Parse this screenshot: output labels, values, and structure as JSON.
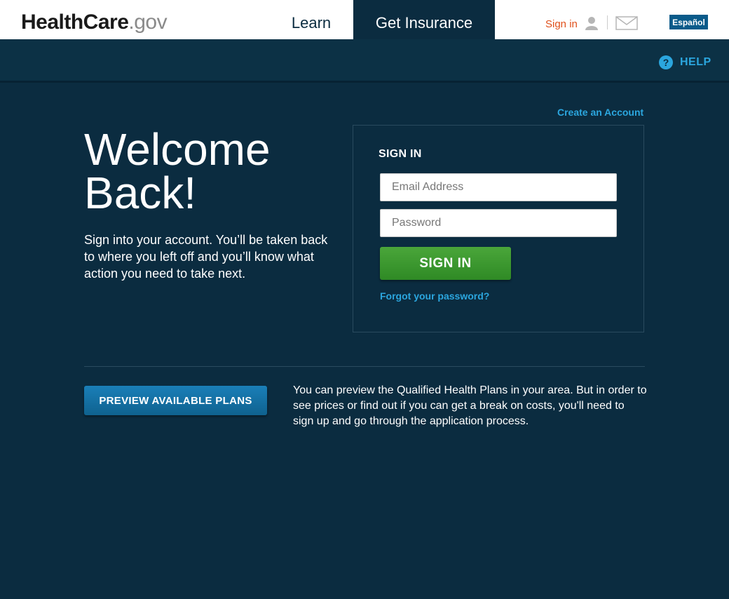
{
  "header": {
    "logo_brand": "HealthCare",
    "logo_dot": ".",
    "logo_tld": "gov",
    "nav": {
      "learn": "Learn",
      "get_insurance": "Get Insurance"
    },
    "sign_in": "Sign in",
    "espanol": "Español"
  },
  "helpbar": {
    "help_icon": "?",
    "help_label": "HELP"
  },
  "main": {
    "create_account": "Create an Account",
    "welcome_line1": "Welcome",
    "welcome_line2": "Back!",
    "intro": "Sign into your account. You’ll be taken back to where you left off and you’ll know what action you need to take next."
  },
  "signin": {
    "title": "SIGN IN",
    "email_placeholder": "Email Address",
    "password_placeholder": "Password",
    "button": "SIGN IN",
    "forgot": "Forgot your password?"
  },
  "preview": {
    "button": "PREVIEW AVAILABLE PLANS",
    "text": "You can preview the Qualified Health Plans in your area. But in order to see prices or find out if you can get a break on costs, you'll need to sign up and go through the application process."
  },
  "colors": {
    "background": "#0b2c40",
    "accent_link": "#2ba6de",
    "signin_green": "#3d9a30",
    "preview_blue": "#1672a6",
    "signin_orange": "#e0501b"
  }
}
